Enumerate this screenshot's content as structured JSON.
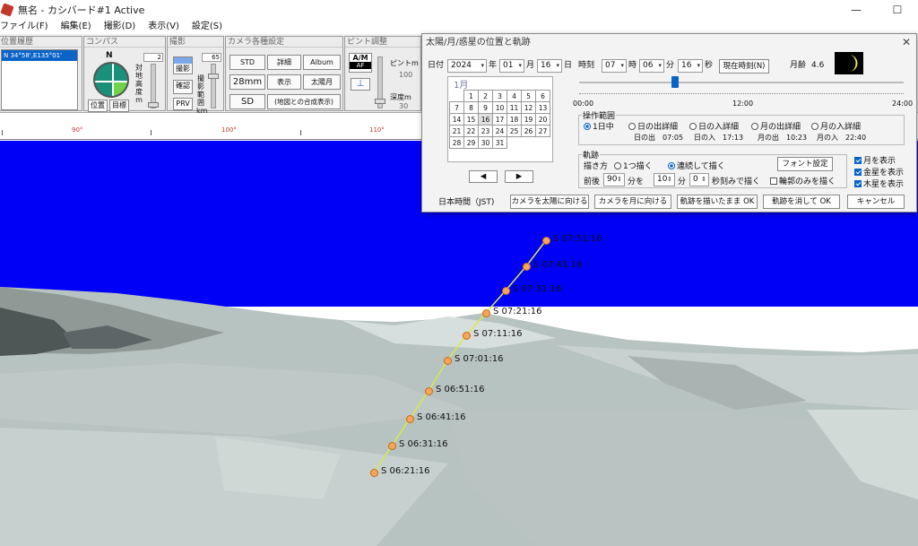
{
  "window": {
    "title": "無名 - カシバード#1 Active",
    "minimize_glyph": "—",
    "maximize_glyph": "☐"
  },
  "menu": [
    "ファイル(F)",
    "編集(E)",
    "撮影(D)",
    "表示(V)",
    "設定(S)"
  ],
  "toolbar": {
    "location": {
      "header": "位置履歴",
      "selected": "N 34°58',E135°01'"
    },
    "compass": {
      "header": "コンパス",
      "north": "N",
      "position_btn": "位置",
      "target_btn": "目標",
      "height_label": "対地高度 m",
      "height_value": "2"
    },
    "shoot": {
      "header": "撮影",
      "shoot_btn": "撮影",
      "confirm_btn": "確認",
      "prv_btn": "PRV",
      "range_label": "撮影範囲 km",
      "range_value": "65"
    },
    "camera": {
      "header": "カメラ各種設定",
      "std": "STD",
      "detail": "詳細",
      "album": "Album",
      "focal": "28mm",
      "display": "表示",
      "sun": "太陽月",
      "sd": "SD",
      "map_composite": "(地図との合成表示)"
    },
    "focus": {
      "header": "ピント調整",
      "am": "A/M",
      "af": "AF",
      "focus_label": "ピントm",
      "focus_value": "100",
      "depth_label": "深度m",
      "depth_value": "30"
    }
  },
  "ruler": {
    "labels": [
      "90°",
      "100°",
      "110°"
    ]
  },
  "scene": {
    "track_color": "#d9e84a",
    "point_color": "#f7a55a",
    "sky_color": "#0000f6",
    "points": [
      {
        "label": "S 07:51:16"
      },
      {
        "label": "S 07:41:16"
      },
      {
        "label": "S 07:31:16"
      },
      {
        "label": "S 07:21:16"
      },
      {
        "label": "S 07:11:16"
      },
      {
        "label": "S 07:01:16"
      },
      {
        "label": "S 06:51:16"
      },
      {
        "label": "S 06:41:16"
      },
      {
        "label": "S 06:31:16"
      },
      {
        "label": "S 06:21:16"
      }
    ]
  },
  "dialog": {
    "title": "太陽/月/惑星の位置と軌跡",
    "close_glyph": "✕",
    "date": {
      "label": "日付",
      "year": "2024",
      "year_unit": "年",
      "month": "01",
      "month_unit": "月",
      "day": "16",
      "day_unit": "日"
    },
    "time": {
      "label": "時刻",
      "hour": "07",
      "hour_unit": "時",
      "minute": "06",
      "minute_unit": "分",
      "second": "16",
      "second_unit": "秒",
      "now_btn": "現在時刻(N)"
    },
    "moon_age": {
      "label": "月齢",
      "value": "4.6"
    },
    "calendar": {
      "month": "1月",
      "weeks": [
        [
          "",
          "1",
          "2",
          "3",
          "4",
          "5",
          "6"
        ],
        [
          "7",
          "8",
          "9",
          "10",
          "11",
          "12",
          "13"
        ],
        [
          "14",
          "15",
          "16",
          "17",
          "18",
          "19",
          "20"
        ],
        [
          "21",
          "22",
          "23",
          "24",
          "25",
          "26",
          "27"
        ],
        [
          "28",
          "29",
          "30",
          "31",
          "",
          "",
          ""
        ]
      ],
      "today": "16",
      "prev": "◀",
      "next": "▶"
    },
    "slider": {
      "start": "00:00",
      "mid": "12:00",
      "end": "24:00",
      "position": 0.296
    },
    "range": {
      "title": "操作範囲",
      "options": [
        "1日中",
        "日の出詳細",
        "日の入詳細",
        "月の出詳細",
        "月の入詳細"
      ],
      "selected": 0,
      "sunrise": "日の出　07:05",
      "sunset": "日の入　17:13",
      "moonrise": "月の出　10:23",
      "moonset": "月の入　22:40"
    },
    "track": {
      "title": "軌跡",
      "draw_label": "描き方",
      "one_by_one": "1つ描く",
      "continuous": "連続して描く",
      "font_btn": "フォント設定",
      "before_after": "前後",
      "minutes_value": "90",
      "minutes_unit": "分を",
      "step_value": "10",
      "step_unit": "分",
      "sec_value": "0",
      "sec_unit": "秒刻みで描く",
      "outline_only": "輪郭のみを描く"
    },
    "checks": {
      "moon": "月を表示",
      "venus": "金星を表示",
      "jupiter": "木星を表示"
    },
    "footer": {
      "timezone": "日本時間（JST)",
      "cam_sun": "カメラを太陽に向ける",
      "cam_moon": "カメラを月に向ける",
      "ok_keep": "軌跡を描いたまま OK",
      "ok_clear": "軌跡を消して OK",
      "cancel": "キャンセル"
    }
  }
}
